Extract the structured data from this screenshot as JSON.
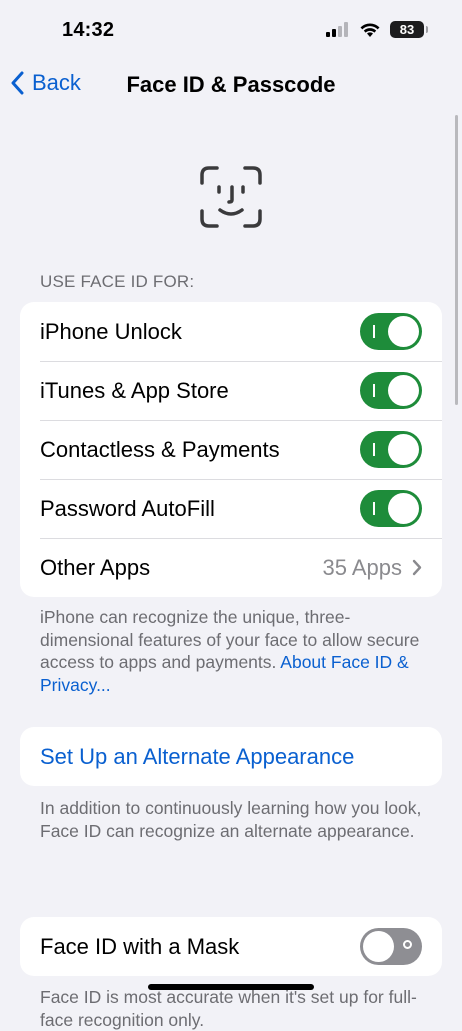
{
  "status": {
    "time": "14:32",
    "battery": "83"
  },
  "nav": {
    "back_label": "Back",
    "title": "Face ID & Passcode"
  },
  "use_face_id": {
    "header": "USE FACE ID FOR:",
    "rows": [
      {
        "label": "iPhone Unlock",
        "on": true
      },
      {
        "label": "iTunes & App Store",
        "on": true
      },
      {
        "label": "Contactless & Payments",
        "on": true
      },
      {
        "label": "Password AutoFill",
        "on": true
      }
    ],
    "other_apps": {
      "label": "Other Apps",
      "value": "35 Apps"
    },
    "footer": "iPhone can recognize the unique, three-dimensional features of your face to allow secure access to apps and payments.",
    "footer_link": "About Face ID & Privacy..."
  },
  "alternate": {
    "action_label": "Set Up an Alternate Appearance",
    "footer_line1": "In addition to continuously learning how you look,",
    "footer_line2": "Face ID can recognize an alternate appearance."
  },
  "mask": {
    "label": "Face ID with a Mask",
    "on": false,
    "footer": "Face ID is most accurate when it's set up for full-face recognition only."
  },
  "colors": {
    "accent": "#0a60d0",
    "toggle_on": "#1e8c3a",
    "toggle_off": "#8e8e93",
    "background": "#f2f2f7"
  },
  "icons": [
    "signal-icon",
    "wifi-icon",
    "battery-icon",
    "chevron-left-icon",
    "face-id-icon",
    "chevron-right-icon"
  ]
}
